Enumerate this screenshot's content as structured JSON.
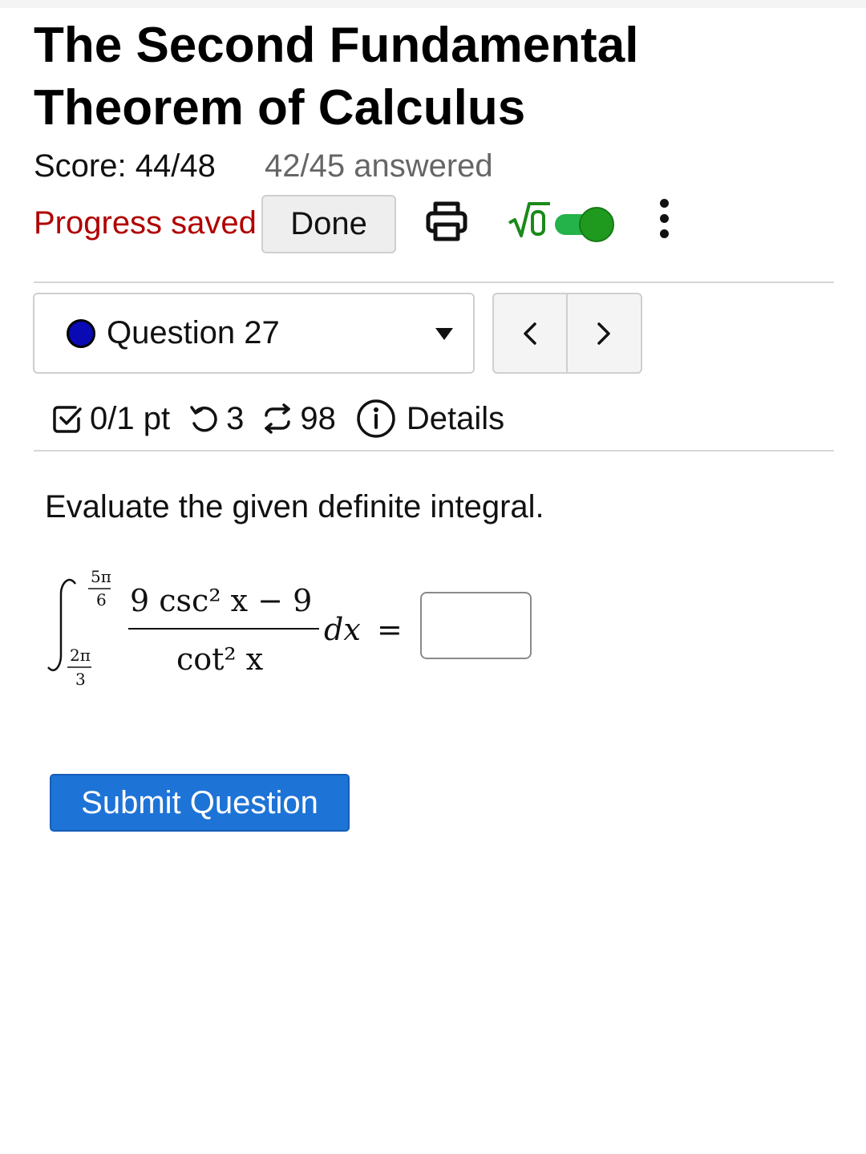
{
  "title": "The Second Fundamental Theorem of Calculus",
  "status": {
    "score": "Score: 44/48",
    "answered": "42/45 answered",
    "progress_text": "Progress saved"
  },
  "toolbar": {
    "done_label": "Done",
    "print_icon": "printer-icon",
    "math_icon": "sqrt-icon",
    "toggle_on": true,
    "more_icon": "kebab-menu-icon"
  },
  "question_nav": {
    "selected": "Question 27",
    "prev_symbol": "<",
    "next_symbol": ">"
  },
  "question_meta": {
    "points": "0/1 pt",
    "retries": "3",
    "versions": "98",
    "details_label": "Details"
  },
  "question": {
    "prompt": "Evaluate the given definite integral.",
    "integral": {
      "upper_num": "5π",
      "upper_den": "6",
      "lower_num": "2π",
      "lower_den": "3",
      "numerator": "9 csc² x − 9",
      "denominator": "cot² x",
      "differential": "dx",
      "equals": "="
    },
    "answer_value": ""
  },
  "submit_label": "Submit Question",
  "colors": {
    "accent": "#1e73d6",
    "progress_red": "#b00000",
    "toggle_green": "#1f9a1f",
    "question_dot": "#0a0ab4"
  }
}
